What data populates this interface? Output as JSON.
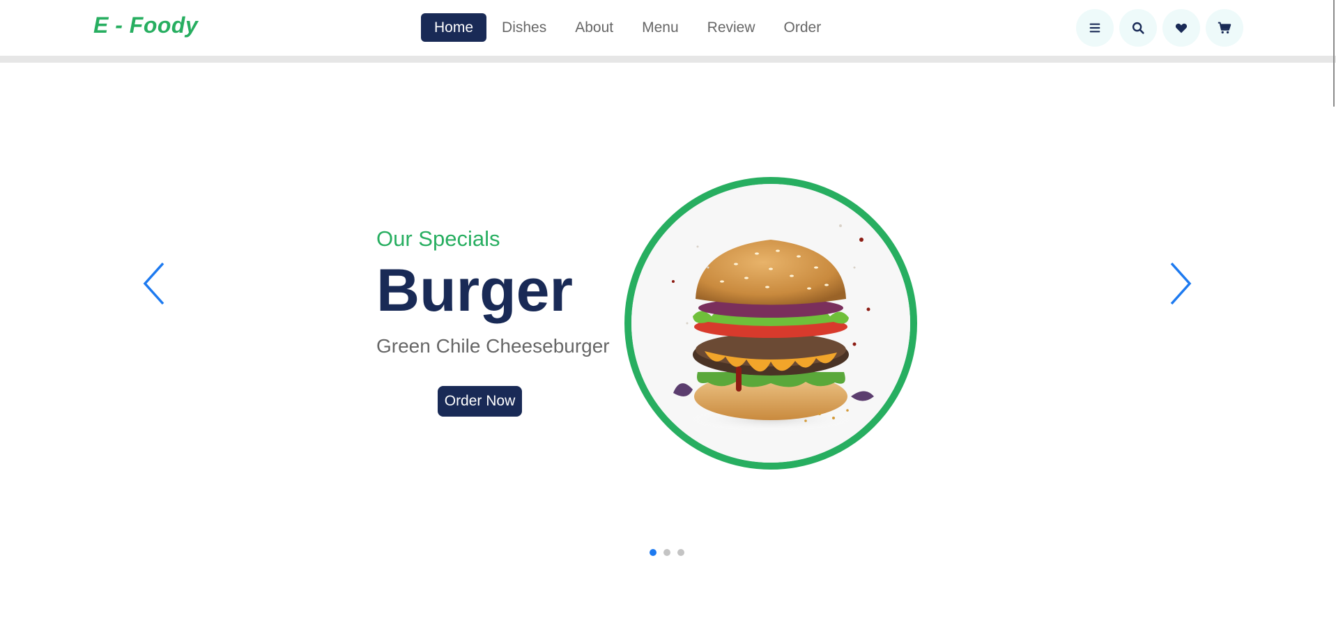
{
  "header": {
    "logo": "E - Foody",
    "nav": [
      {
        "label": "Home",
        "active": true
      },
      {
        "label": "Dishes",
        "active": false
      },
      {
        "label": "About",
        "active": false
      },
      {
        "label": "Menu",
        "active": false
      },
      {
        "label": "Review",
        "active": false
      },
      {
        "label": "Order",
        "active": false
      }
    ],
    "icons": [
      "menu-bars-icon",
      "search-icon",
      "heart-icon",
      "shopping-cart-icon"
    ]
  },
  "slider": {
    "subtitle": "Our Specials",
    "title": "Burger",
    "description": "Green Chile Cheeseburger",
    "button_label": "Order Now",
    "image": "burger-image",
    "slide_count": 3,
    "active_slide": 1
  },
  "colors": {
    "brand_green": "#27ae60",
    "navy": "#192a56",
    "text_gray": "#666666",
    "arrow_blue": "#1d7af0"
  }
}
